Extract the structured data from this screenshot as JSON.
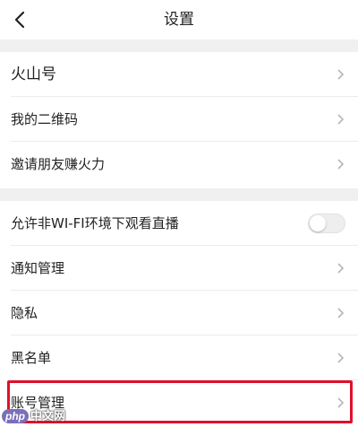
{
  "header": {
    "title": "设置"
  },
  "groups": [
    {
      "items": [
        {
          "label": "火山号"
        },
        {
          "label": "我的二维码"
        },
        {
          "label": "邀请朋友赚火力"
        }
      ]
    },
    {
      "items": [
        {
          "label": "允许非WI-FI环境下观看直播",
          "toggle": false
        },
        {
          "label": "通知管理"
        },
        {
          "label": "隐私"
        },
        {
          "label": "黑名单"
        },
        {
          "label": "账号管理"
        }
      ]
    }
  ],
  "watermark": {
    "badge": "php",
    "text": "中文网"
  },
  "colors": {
    "highlight": "#e0102a",
    "background": "#f2f2f2"
  }
}
